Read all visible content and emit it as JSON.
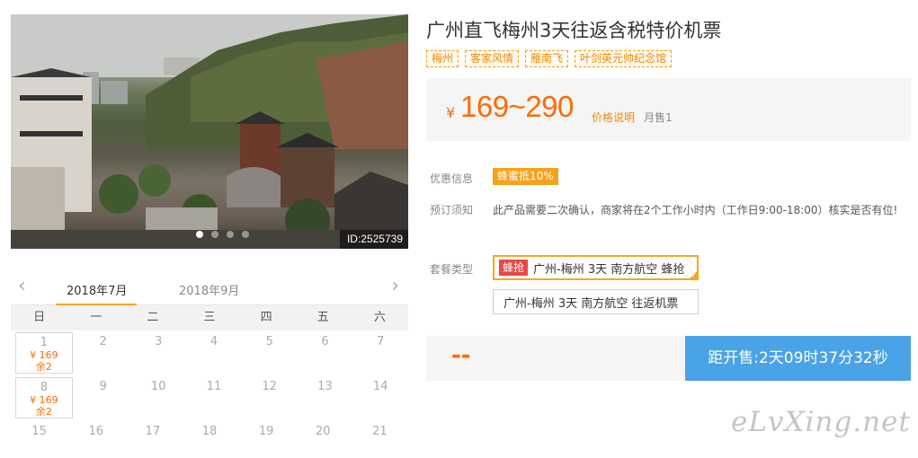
{
  "photo": {
    "id_label": "ID:2525739",
    "slides": 4,
    "active_slide": 1
  },
  "calendar": {
    "prev_icon": "chevron-left-icon",
    "next_icon": "chevron-right-icon",
    "months": [
      {
        "label": "2018年7月",
        "active": true
      },
      {
        "label": "2018年9月",
        "active": false
      }
    ],
    "weekdays": [
      "日",
      "一",
      "二",
      "三",
      "四",
      "五",
      "六"
    ],
    "rows": [
      [
        {
          "date": "1",
          "price": "¥ 169",
          "left": "余2"
        },
        {
          "date": "2"
        },
        {
          "date": "3"
        },
        {
          "date": "4"
        },
        {
          "date": "5"
        },
        {
          "date": "6"
        },
        {
          "date": "7"
        }
      ],
      [
        {
          "date": "8",
          "price": "¥ 169",
          "left": "余2"
        },
        {
          "date": "9"
        },
        {
          "date": "10"
        },
        {
          "date": "11"
        },
        {
          "date": "12"
        },
        {
          "date": "13"
        },
        {
          "date": "14"
        }
      ],
      [
        {
          "date": "15"
        },
        {
          "date": "16"
        },
        {
          "date": "17"
        },
        {
          "date": "18"
        },
        {
          "date": "19"
        },
        {
          "date": "20"
        },
        {
          "date": "21"
        }
      ]
    ]
  },
  "product": {
    "title": "广州直飞梅州3天往返含税特价机票",
    "tags": [
      "梅州",
      "客家风情",
      "雁南飞",
      "叶剑英元帅纪念馆"
    ],
    "price": {
      "currency": "¥",
      "range": "169~290",
      "explain": "价格说明",
      "sold": "月售1"
    },
    "discount": {
      "label": "优惠信息",
      "badge": "蜂蜜抵10%"
    },
    "notice": {
      "label": "预订须知",
      "text": "此产品需要二次确认，商家将在2个工作小时内（工作日9:00-18:00）核实是否有位!"
    },
    "packages": {
      "label": "套餐类型",
      "items": [
        {
          "badge": "蜂抢",
          "name": "广州-梅州 3天 南方航空 蜂抢",
          "selected": true
        },
        {
          "name": "广州-梅州 3天 南方航空 往返机票",
          "selected": false
        }
      ]
    },
    "buy": {
      "placeholder_price": "--",
      "countdown": "距开售:2天09时37分32秒"
    }
  },
  "watermark": "eLvXing.net",
  "colors": {
    "accent_orange": "#ff6a00",
    "tag_border": "#f39c12",
    "selected_border": "#f5a623",
    "badge_red": "#e8484a",
    "button_blue": "#4aa3e6"
  }
}
